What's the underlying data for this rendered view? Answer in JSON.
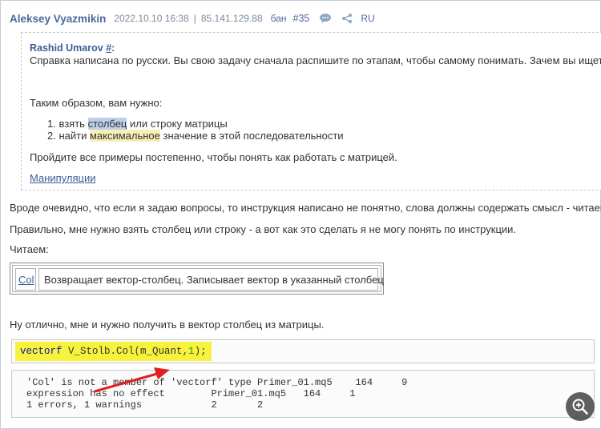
{
  "header": {
    "author": "Aleksey Vyazmikin",
    "datetime": "2022.10.10 16:38",
    "separator": "|",
    "ip": "85.141.129.88",
    "ban": "бан",
    "post_number": "#35",
    "lang": "RU"
  },
  "quote": {
    "author": "Rashid Umarov",
    "author_link": "#",
    "author_suffix": ":",
    "line1": "Справка написана по русски. Вы свою задачу сначала распишите по этапам, чтобы самому понимать. Зачем вы ищете",
    "intro": "Таким образом, вам нужно:",
    "item1_pre": "1. взять ",
    "item1_hl": "столбец",
    "item1_post": " или строку матрицы",
    "item2_pre": "2. найти ",
    "item2_hl": "максимальное",
    "item2_post": " значение в этой последовательности",
    "advice": "Пройдите все примеры постепенно, чтобы понять как работать с матрицей.",
    "link": "Манипуляции"
  },
  "body": {
    "line1": "Вроде очевидно, что если я задаю вопросы, то инструкция написано не понятно, слова должны содержать смысл - читаем",
    "line2": "Правильно, мне нужно взять столбец или строку - а вот как это сделать я не могу понять по инструкции.",
    "line3": "Читаем:",
    "col_name": "Col",
    "col_desc": "Возвращает вектор-столбец. Записывает вектор в указанный столбец",
    "line4": "Ну отлично, мне и нужно получить в вектор столбец из матрицы."
  },
  "code1": {
    "type": "vectorf",
    "rest_pre": " V_Stolb.Col(m_Quant,",
    "arg": "1",
    "rest_post": ");"
  },
  "code2": {
    "output": "'Col' is not a member of 'vectorf' type Primer_01.mq5    164     9\nexpression has no effect        Primer_01.mq5   164     1\n1 errors, 1 warnings            2       2"
  },
  "colors": {
    "author": "#4a6a9e",
    "highlight_yellow": "#f7f33c",
    "arrow": "#e02020"
  },
  "icons": {
    "comment": "speech-bubble-icon",
    "share": "share-icon",
    "zoom": "zoom-in-icon"
  }
}
